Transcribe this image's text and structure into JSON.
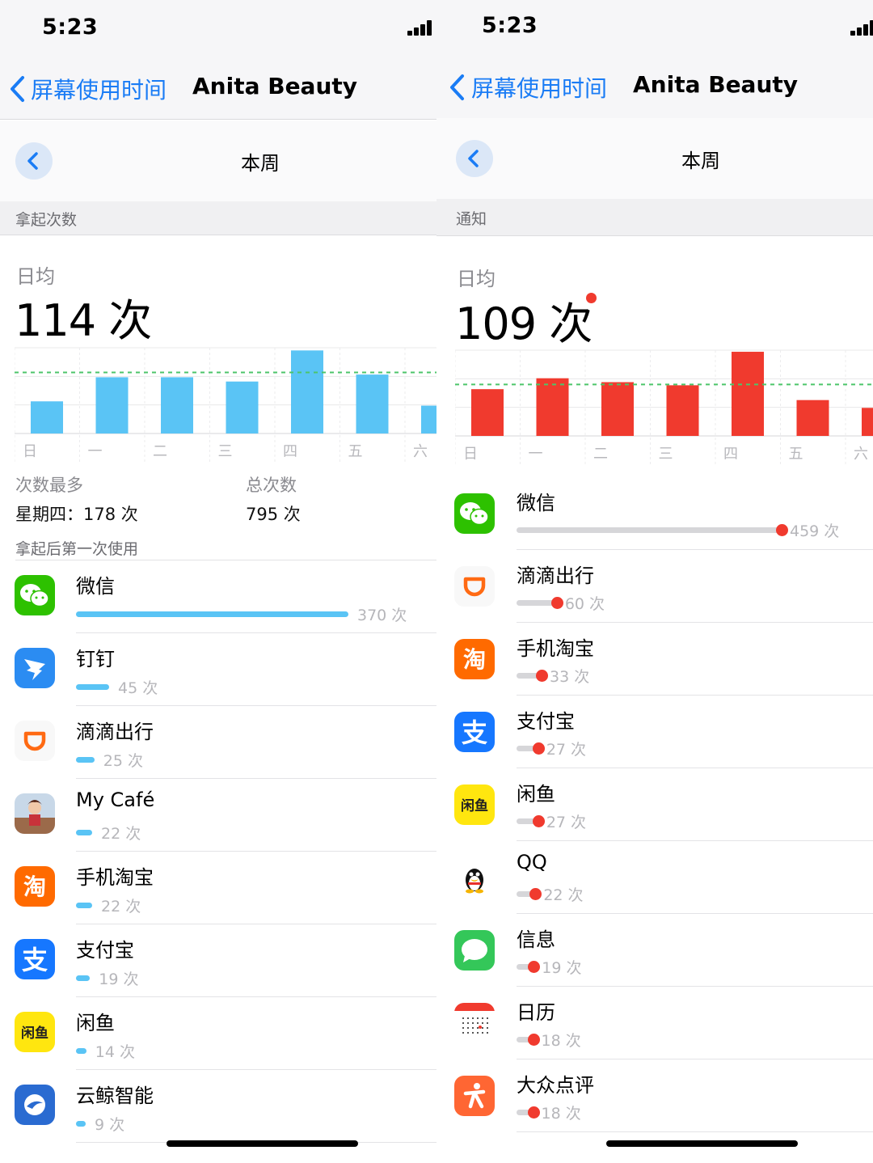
{
  "status": {
    "time": "5:23"
  },
  "nav": {
    "back_label": "屏幕使用时间",
    "title": "Anita Beauty"
  },
  "week": {
    "label": "本周"
  },
  "left": {
    "section": "拿起次数",
    "avg_label": "日均",
    "avg_value": "114 次",
    "days": [
      "日",
      "一",
      "二",
      "三",
      "四",
      "五",
      "六"
    ],
    "chart_data": {
      "type": "bar",
      "categories": [
        "日",
        "一",
        "二",
        "三",
        "四",
        "五",
        "六"
      ],
      "values": [
        60,
        105,
        105,
        97,
        155,
        110,
        52
      ],
      "average": 114,
      "color": "#5ac4f5",
      "ylim": [
        0,
        160
      ]
    },
    "stats": {
      "most_label": "次数最多",
      "most_value": "星期四：178 次",
      "total_label": "总次数",
      "total_value": "795 次"
    },
    "first_use_header": "拿起后第一次使用",
    "apps": [
      {
        "name": "微信",
        "count": "370 次",
        "value": 370,
        "icon": "wechat-icon",
        "color": "#2dc100"
      },
      {
        "name": "钉钉",
        "count": "45 次",
        "value": 45,
        "icon": "dingtalk-icon",
        "color": "#2b8cf2"
      },
      {
        "name": "滴滴出行",
        "count": "25 次",
        "value": 25,
        "icon": "didi-icon",
        "color": "#ffffff"
      },
      {
        "name": "My Café",
        "count": "22 次",
        "value": 22,
        "icon": "mycafe-icon",
        "color": "#d77a5a"
      },
      {
        "name": "手机淘宝",
        "count": "22 次",
        "value": 22,
        "icon": "taobao-icon",
        "color": "#ff6a00"
      },
      {
        "name": "支付宝",
        "count": "19 次",
        "value": 19,
        "icon": "alipay-icon",
        "color": "#1677ff"
      },
      {
        "name": "闲鱼",
        "count": "14 次",
        "value": 14,
        "icon": "xianyu-icon",
        "color": "#ffe60f"
      },
      {
        "name": "云鲸智能",
        "count": "9 次",
        "value": 9,
        "icon": "narwal-icon",
        "color": "#2a6bd1"
      }
    ]
  },
  "right": {
    "section": "通知",
    "avg_label": "日均",
    "avg_value": "109 次",
    "days": [
      "日",
      "一",
      "二",
      "三",
      "四",
      "五",
      "六"
    ],
    "chart_data": {
      "type": "bar",
      "categories": [
        "日",
        "一",
        "二",
        "三",
        "四",
        "五",
        "六"
      ],
      "values": [
        60,
        74,
        69,
        65,
        108,
        46,
        36
      ],
      "average": 66,
      "color": "#f03a2e",
      "ylim": [
        0,
        110
      ]
    },
    "apps": [
      {
        "name": "微信",
        "count": "459 次",
        "value": 459,
        "icon": "wechat-icon",
        "color": "#2dc100"
      },
      {
        "name": "滴滴出行",
        "count": "60 次",
        "value": 60,
        "icon": "didi-icon",
        "color": "#ffffff"
      },
      {
        "name": "手机淘宝",
        "count": "33 次",
        "value": 33,
        "icon": "taobao-icon",
        "color": "#ff6a00"
      },
      {
        "name": "支付宝",
        "count": "27 次",
        "value": 27,
        "icon": "alipay-icon",
        "color": "#1677ff"
      },
      {
        "name": "闲鱼",
        "count": "27 次",
        "value": 27,
        "icon": "xianyu-icon",
        "color": "#ffe60f"
      },
      {
        "name": "QQ",
        "count": "22 次",
        "value": 22,
        "icon": "qq-icon",
        "color": "#ffffff"
      },
      {
        "name": "信息",
        "count": "19 次",
        "value": 19,
        "icon": "messages-icon",
        "color": "#34c759"
      },
      {
        "name": "日历",
        "count": "18 次",
        "value": 18,
        "icon": "calendar-icon",
        "color": "#ffffff"
      },
      {
        "name": "大众点评",
        "count": "18 次",
        "value": 18,
        "icon": "dianping-icon",
        "color": "#ff6633"
      }
    ]
  }
}
